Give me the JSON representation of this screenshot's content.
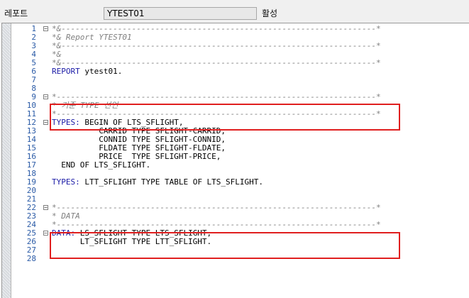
{
  "header": {
    "report_label": "레포트",
    "report_name": "YTEST01",
    "status": "활성"
  },
  "colors": {
    "keyword": "#1a1aa6",
    "comment": "#7f7f7f",
    "highlight": "#e01f1f",
    "line_number": "#2a5aa6"
  },
  "code": [
    {
      "n": "1",
      "fold": true,
      "t": "*&-------------------------------------------------------------------*",
      "c": true
    },
    {
      "n": "2",
      "fold": false,
      "t": "*& Report YTEST01",
      "c": true
    },
    {
      "n": "3",
      "fold": false,
      "t": "*&-------------------------------------------------------------------*",
      "c": true
    },
    {
      "n": "4",
      "fold": false,
      "t": "*&",
      "c": true
    },
    {
      "n": "5",
      "fold": false,
      "t": "*&-------------------------------------------------------------------*",
      "c": true
    },
    {
      "n": "6",
      "fold": false,
      "kw": "REPORT",
      "t": " ytest01."
    },
    {
      "n": "7",
      "fold": false,
      "t": ""
    },
    {
      "n": "8",
      "fold": false,
      "t": ""
    },
    {
      "n": "9",
      "fold": true,
      "t": "*--------------------------------------------------------------------*",
      "c": true
    },
    {
      "n": "10",
      "fold": false,
      "t": "* 기준 TYPE 선언",
      "c": true
    },
    {
      "n": "11",
      "fold": false,
      "t": "*--------------------------------------------------------------------*",
      "c": true
    },
    {
      "n": "12",
      "fold": true,
      "kw": "TYPES:",
      "t": " BEGIN OF LTS_SFLIGHT,"
    },
    {
      "n": "13",
      "fold": false,
      "t": "          CARRID TYPE SFLIGHT-CARRID,"
    },
    {
      "n": "14",
      "fold": false,
      "t": "          CONNID TYPE SFLIGHT-CONNID,"
    },
    {
      "n": "15",
      "fold": false,
      "t": "          FLDATE TYPE SFLIGHT-FLDATE,"
    },
    {
      "n": "16",
      "fold": false,
      "t": "          PRICE  TYPE SFLIGHT-PRICE,"
    },
    {
      "n": "17",
      "fold": false,
      "t": "  END OF LTS_SFLIGHT."
    },
    {
      "n": "18",
      "fold": false,
      "t": ""
    },
    {
      "n": "19",
      "fold": false,
      "kw": "TYPES:",
      "t": " LTT_SFLIGHT TYPE TABLE OF LTS_SFLIGHT."
    },
    {
      "n": "20",
      "fold": false,
      "t": ""
    },
    {
      "n": "21",
      "fold": false,
      "t": ""
    },
    {
      "n": "22",
      "fold": true,
      "t": "*--------------------------------------------------------------------*",
      "c": true
    },
    {
      "n": "23",
      "fold": false,
      "t": "* DATA",
      "c": true
    },
    {
      "n": "24",
      "fold": false,
      "t": "*--------------------------------------------------------------------*",
      "c": true
    },
    {
      "n": "25",
      "fold": true,
      "kw": "DATA:",
      "t": " LS_SFLIGHT TYPE LTS_SFLIGHT,"
    },
    {
      "n": "26",
      "fold": false,
      "t": "      LT_SFLIGHT TYPE LTT_SFLIGHT."
    },
    {
      "n": "27",
      "fold": false,
      "t": ""
    },
    {
      "n": "28",
      "fold": false,
      "t": ""
    }
  ]
}
